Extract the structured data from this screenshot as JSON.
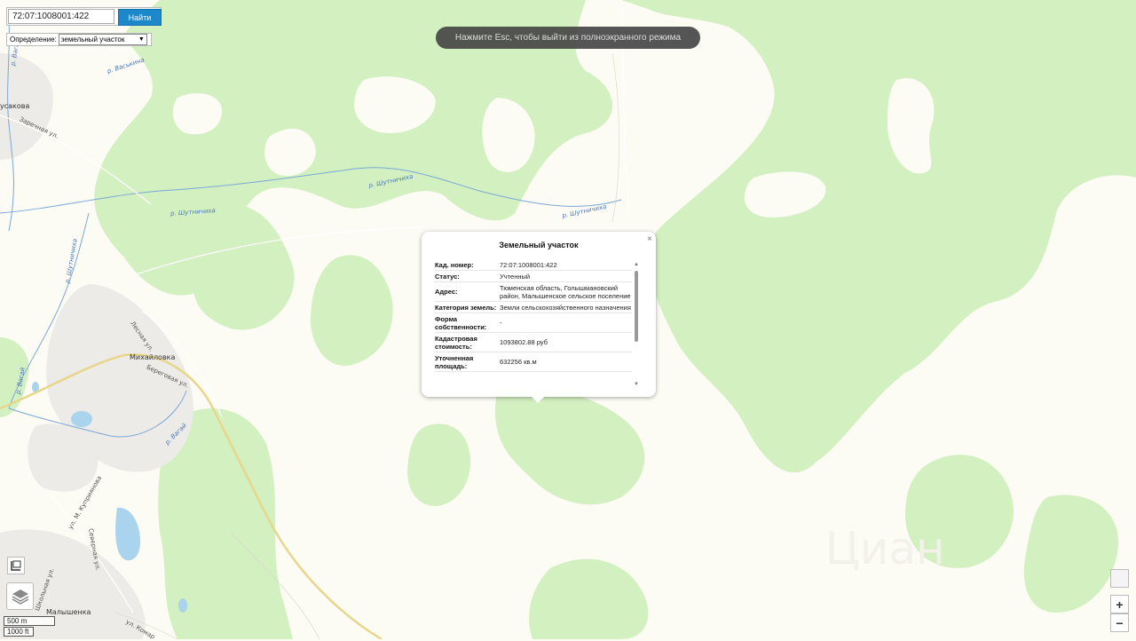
{
  "search": {
    "value": "72:07:1008001:422",
    "button_label": "Найти",
    "definition_label": "Определение:",
    "definition_value": "земельный участок"
  },
  "fullscreen_hint": "Нажмите Esc, чтобы выйти из полноэкранного режима",
  "popup": {
    "title": "Земельный участок",
    "close_label": "×",
    "rows": [
      {
        "key": "Кад. номер:",
        "value": "72:07:1008001:422"
      },
      {
        "key": "Статус:",
        "value": "Учтенный"
      },
      {
        "key": "Адрес:",
        "value": "Тюменская область, Голышмановский район, Малышенское сельское поселение"
      },
      {
        "key": "Категория земель:",
        "value": "Земли сельскохозяйственного назначения"
      },
      {
        "key": "Форма собственности:",
        "value": "-"
      },
      {
        "key": "Кадастровая стоимость:",
        "value": "1093802.88 руб"
      },
      {
        "key": "Уточненная площадь:",
        "value": "632256 кв.м"
      }
    ]
  },
  "map": {
    "places": {
      "usakova": "усакова",
      "mikhaylovka": "Михайловка",
      "malyshenka": "Малышенка"
    },
    "rivers": {
      "vaskina": "р. Васькина",
      "shutnichikha_1": "р. Шутничиха",
      "shutnichikha_2": "р. Шутничиха",
      "shutnichikha_3": "р. Шутничиха",
      "vagay": "р. Вагай",
      "vagay_2": "р. Вагай",
      "vagay_3": "р. Вагай",
      "shut_v": "р. Шутничиха"
    },
    "streets": {
      "zarechnaya": "Заречная ул.",
      "lesnaya": "Лесная ул.",
      "beregovaya": "Береговая ул.",
      "kupriyanova": "ул. М. Куприянова",
      "severnaya": "Северная ул.",
      "komar": "ул. Комар",
      "school": "Школьная ул."
    },
    "watermark": "Циан"
  },
  "controls": {
    "zoom_in": "+",
    "zoom_out": "−",
    "scale_metric": "500 m",
    "scale_imperial": "1000 ft"
  },
  "colors": {
    "background": "#fcfbf4",
    "forest": "#d3f0c0",
    "water": "#aad3ee",
    "accent_button": "#1c87c9"
  },
  "icons": {
    "layers": "layers-icon",
    "fullscreen": "fullscreen-icon",
    "close": "close-icon"
  }
}
